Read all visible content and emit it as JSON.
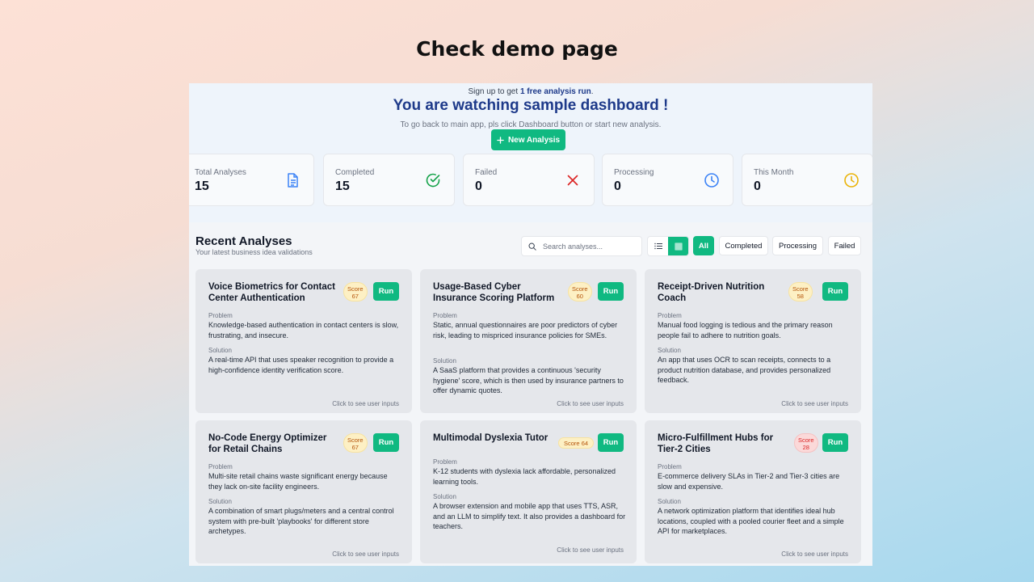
{
  "slide_title": "Check demo page",
  "banner": {
    "signup_prefix": "Sign up to get ",
    "signup_bold": "1 free analysis run",
    "signup_suffix": ".",
    "headline": "You are watching sample dashboard !",
    "subline": "To go back to main app, pls click Dashboard button or start new analysis.",
    "new_button": "New Analysis"
  },
  "stats": [
    {
      "label": "Total Analyses",
      "value": "15",
      "icon": "document-icon",
      "color": "#3b82f6"
    },
    {
      "label": "Completed",
      "value": "15",
      "icon": "check-circle-icon",
      "color": "#16a34a"
    },
    {
      "label": "Failed",
      "value": "0",
      "icon": "x-icon",
      "color": "#dc2626"
    },
    {
      "label": "Processing",
      "value": "0",
      "icon": "clock-icon",
      "color": "#3b82f6"
    },
    {
      "label": "This Month",
      "value": "0",
      "icon": "clock-icon",
      "color": "#eab308"
    }
  ],
  "recent": {
    "title": "Recent Analyses",
    "subtitle": "Your latest business idea validations",
    "search_placeholder": "Search analyses...",
    "filters": [
      "All",
      "Completed",
      "Processing",
      "Failed"
    ],
    "active_filter": "All"
  },
  "labels": {
    "problem": "Problem",
    "solution": "Solution",
    "run": "Run",
    "footer": "Click to see user inputs"
  },
  "accent": "#10b981",
  "cards": [
    {
      "title": "Voice Biometrics for Contact Center Authentication",
      "score_label": "Score",
      "score": "67",
      "problem": "Knowledge-based authentication in contact centers is slow, frustrating, and insecure.",
      "solution": "A real-time API that uses speaker recognition to provide a high-confidence identity verification score."
    },
    {
      "title": "Usage-Based Cyber Insurance Scoring Platform",
      "score_label": "Score",
      "score": "60",
      "problem": "Static, annual questionnaires are poor predictors of cyber risk, leading to mispriced insurance policies for SMEs.",
      "solution": "A SaaS platform that provides a continuous 'security hygiene' score, which is then used by insurance partners to offer dynamic quotes."
    },
    {
      "title": "Receipt-Driven Nutrition Coach",
      "score_label": "Score",
      "score": "58",
      "problem": "Manual food logging is tedious and the primary reason people fail to adhere to nutrition goals.",
      "solution": "An app that uses OCR to scan receipts, connects to a product nutrition database, and provides personalized feedback."
    },
    {
      "title": "No-Code Energy Optimizer for Retail Chains",
      "score_label": "Score",
      "score": "67",
      "problem": "Multi-site retail chains waste significant energy because they lack on-site facility engineers.",
      "solution": "A combination of smart plugs/meters and a central control system with pre-built 'playbooks' for different store archetypes."
    },
    {
      "title": "Multimodal Dyslexia Tutor",
      "score_label": "Score",
      "score": "64",
      "problem": "K-12 students with dyslexia lack affordable, personalized learning tools.",
      "solution": "A browser extension and mobile app that uses TTS, ASR, and an LLM to simplify text. It also provides a dashboard for teachers."
    },
    {
      "title": "Micro-Fulfillment Hubs for Tier-2 Cities",
      "score_label": "Score",
      "score": "28",
      "problem": "E-commerce delivery SLAs in Tier-2 and Tier-3 cities are slow and expensive.",
      "solution": "A network optimization platform that identifies ideal hub locations, coupled with a pooled courier fleet and a simple API for marketplaces."
    }
  ]
}
